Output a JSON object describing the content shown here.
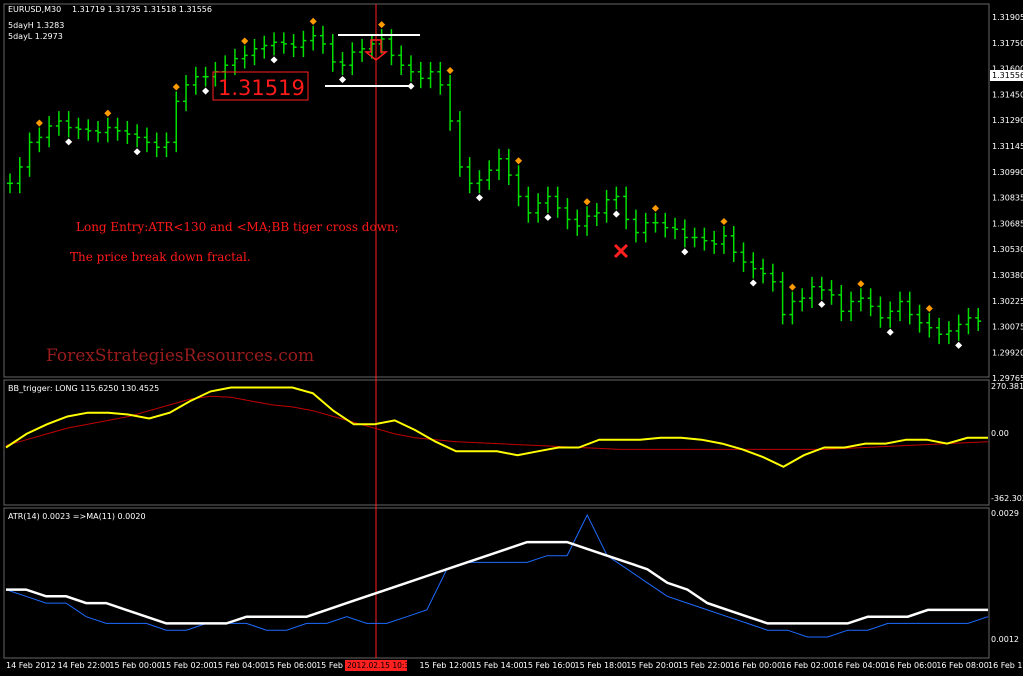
{
  "window": {
    "symbol_tf": "EURUSD,M30",
    "ohlc": "1.31719 1.31735 1.31518 1.31556",
    "five_day_high": "5dayH 1.3283",
    "five_day_low": "5dayL 1.2973"
  },
  "price_panel": {
    "price_axis": [
      "1.31905",
      "1.31750",
      "1.31600",
      "1.31450",
      "1.31290",
      "1.31145",
      "1.30990",
      "1.30835",
      "1.30685",
      "1.30530",
      "1.30380",
      "1.30225",
      "1.30075",
      "1.29920",
      "1.29765"
    ],
    "current_price": "1.31556",
    "big_price": "1.31519",
    "notes": [
      "Long Entry:ATR<130 and <MA;BB tiger cross down;",
      "The price break down fractal."
    ],
    "watermark": "ForexStrategiesResources.com"
  },
  "bb_panel": {
    "header": "BB_trigger: LONG 115.6250 130.4525",
    "axis": [
      "270.3817",
      "0.00",
      "-362.302"
    ]
  },
  "atr_panel": {
    "header": "ATR(14) 0.0023 =>MA(11) 0.0020",
    "axis": [
      "0.0029",
      "0.0012"
    ]
  },
  "time_axis": {
    "labels": [
      "14 Feb 2012",
      "14 Feb 22:00",
      "15 Feb 00:00",
      "15 Feb 02:00",
      "15 Feb 04:00",
      "15 Feb 06:00",
      "15 Feb 08",
      "15 Feb 12:00",
      "15 Feb 14:00",
      "15 Feb 16:00",
      "15 Feb 18:00",
      "15 Feb 20:00",
      "15 Feb 22:00",
      "16 Feb 00:00",
      "16 Feb 02:00",
      "16 Feb 04:00",
      "16 Feb 06:00",
      "16 Feb 08:00",
      "16 Feb 10:00"
    ],
    "cursor_label": "2012.02.15 10:30"
  },
  "chart_data": {
    "type": "line",
    "candles_close": [
      1.309,
      1.31,
      1.3115,
      1.3118,
      1.3125,
      1.3128,
      1.3124,
      1.3123,
      1.3122,
      1.3121,
      1.3124,
      1.3122,
      1.312,
      1.3118,
      1.3115,
      1.3112,
      1.3115,
      1.314,
      1.315,
      1.3155,
      1.3155,
      1.3158,
      1.3162,
      1.3166,
      1.3168,
      1.3172,
      1.3174,
      1.3176,
      1.3175,
      1.3173,
      1.3177,
      1.318,
      1.3175,
      1.3164,
      1.3162,
      1.317,
      1.3172,
      1.3175,
      1.3178,
      1.3168,
      1.3162,
      1.3158,
      1.3154,
      1.3158,
      1.315,
      1.3128,
      1.31,
      1.309,
      1.3092,
      1.3098,
      1.3105,
      1.3095,
      1.3082,
      1.3072,
      1.3078,
      1.3082,
      1.3075,
      1.3068,
      1.3064,
      1.307,
      1.3072,
      1.308,
      1.3082,
      1.3068,
      1.306,
      1.3066,
      1.3066,
      1.3063,
      1.3062,
      1.3057,
      1.3057,
      1.3055,
      1.3053,
      1.3058,
      1.3048,
      1.3042,
      1.3038,
      1.3035,
      1.303,
      1.301,
      1.3018,
      1.302,
      1.3027,
      1.3025,
      1.3022,
      1.3012,
      1.3018,
      1.302,
      1.3015,
      1.3008,
      1.3012,
      1.3018,
      1.301,
      1.3005,
      1.3002,
      1.2998,
      1.3,
      1.3004,
      1.3008,
      1.3006
    ],
    "bb_yellow": [
      -80,
      -10,
      40,
      80,
      100,
      100,
      90,
      70,
      100,
      160,
      210,
      230,
      230,
      230,
      230,
      200,
      110,
      40,
      40,
      60,
      10,
      -50,
      -100,
      -100,
      -100,
      -120,
      -100,
      -80,
      -80,
      -40,
      -40,
      -40,
      -30,
      -30,
      -40,
      -60,
      -90,
      -130,
      -180,
      -120,
      -80,
      -80,
      -60,
      -60,
      -40,
      -40,
      -60,
      -30,
      -30
    ],
    "bb_red": [
      -70,
      -40,
      -10,
      20,
      40,
      60,
      80,
      110,
      140,
      170,
      185,
      180,
      160,
      140,
      130,
      110,
      80,
      50,
      20,
      -10,
      -30,
      -40,
      -50,
      -55,
      -60,
      -65,
      -70,
      -75,
      -80,
      -85,
      -90,
      -90,
      -90,
      -90,
      -90,
      -90,
      -90,
      -90,
      -90,
      -90,
      -90,
      -85,
      -80,
      -75,
      -70,
      -65,
      -60,
      -55,
      -50
    ],
    "atr_blue": [
      0.0018,
      0.0017,
      0.0016,
      0.0016,
      0.0014,
      0.0013,
      0.0013,
      0.0013,
      0.0012,
      0.0012,
      0.0013,
      0.0013,
      0.0013,
      0.0012,
      0.0012,
      0.0013,
      0.0013,
      0.0014,
      0.0013,
      0.0013,
      0.0014,
      0.0015,
      0.0021,
      0.0022,
      0.0022,
      0.0022,
      0.0022,
      0.0023,
      0.0023,
      0.0029,
      0.0023,
      0.0021,
      0.0019,
      0.0017,
      0.0016,
      0.0015,
      0.0014,
      0.0013,
      0.0012,
      0.0012,
      0.0011,
      0.0011,
      0.0012,
      0.0012,
      0.0013,
      0.0013,
      0.0013,
      0.0013,
      0.0013,
      0.0014
    ],
    "atr_white": [
      0.0018,
      0.0018,
      0.0017,
      0.0017,
      0.0016,
      0.0016,
      0.0015,
      0.0014,
      0.0013,
      0.0013,
      0.0013,
      0.0013,
      0.0014,
      0.0014,
      0.0014,
      0.0014,
      0.0015,
      0.0016,
      0.0017,
      0.0018,
      0.0019,
      0.002,
      0.0021,
      0.0022,
      0.0023,
      0.0024,
      0.0025,
      0.0025,
      0.0025,
      0.0024,
      0.0023,
      0.0022,
      0.0021,
      0.0019,
      0.0018,
      0.0016,
      0.0015,
      0.0014,
      0.0013,
      0.0013,
      0.0013,
      0.0013,
      0.0013,
      0.0014,
      0.0014,
      0.0014,
      0.0015,
      0.0015,
      0.0015,
      0.0015
    ],
    "colors": {
      "bull": "#00e000",
      "bear": "#00e000",
      "yellow": "#ffff00",
      "red": "#c00000",
      "blue": "#1e6bff",
      "white": "#ffffff",
      "fractal_up": "#ff9a00",
      "fractal_dn": "#ffffff"
    }
  }
}
